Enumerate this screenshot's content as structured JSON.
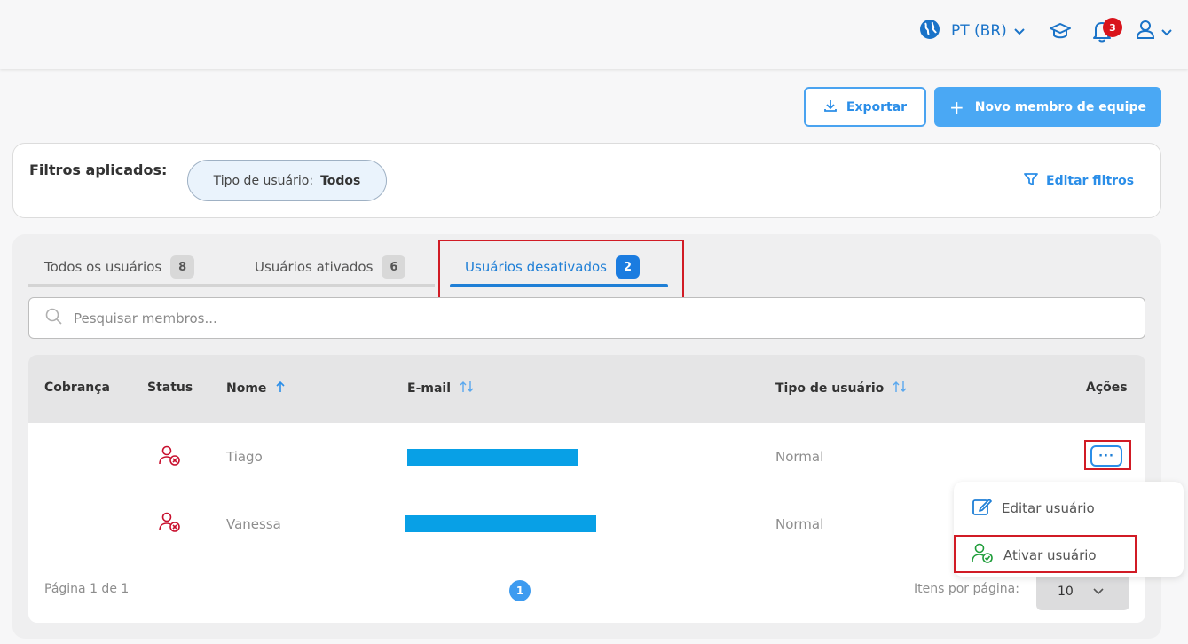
{
  "header": {
    "language": "PT (BR)",
    "notifications_count": "3",
    "icons": [
      "globe-icon",
      "chevron-down-icon",
      "graduation-cap-icon",
      "bell-icon",
      "user-icon"
    ]
  },
  "actions": {
    "export_label": "Exportar",
    "new_member_label": "Novo membro de equipe",
    "new_member_plus": "+"
  },
  "filters": {
    "title": "Filtros aplicados:",
    "chip_key": "Tipo de usuário:",
    "chip_value": "Todos",
    "edit_label": "Editar filtros"
  },
  "tabs": [
    {
      "label": "Todos os usuários",
      "count": "8"
    },
    {
      "label": "Usuários ativados",
      "count": "6"
    },
    {
      "label": "Usuários desativados",
      "count": "2"
    }
  ],
  "search": {
    "placeholder": "Pesquisar membros..."
  },
  "table": {
    "columns": [
      "Cobrança",
      "Status",
      "Nome",
      "E-mail",
      "Tipo de usuário",
      "Ações"
    ],
    "rows": [
      {
        "name": "Tiago",
        "type": "Normal"
      },
      {
        "name": "Vanessa",
        "type": "Normal"
      }
    ],
    "actions_button": "···"
  },
  "pagination": {
    "page_text": "Página 1 de 1",
    "current_page": "1",
    "per_page_label": "Itens por página:",
    "per_page_value": "10"
  },
  "menu": {
    "edit_user": "Editar usuário",
    "activate_user": "Ativar usuário"
  },
  "colors": {
    "accent": "#1f7fd6",
    "primary_button": "#4aa8f4",
    "highlight": "#d11b25",
    "disabled_status": "#c8102e"
  }
}
